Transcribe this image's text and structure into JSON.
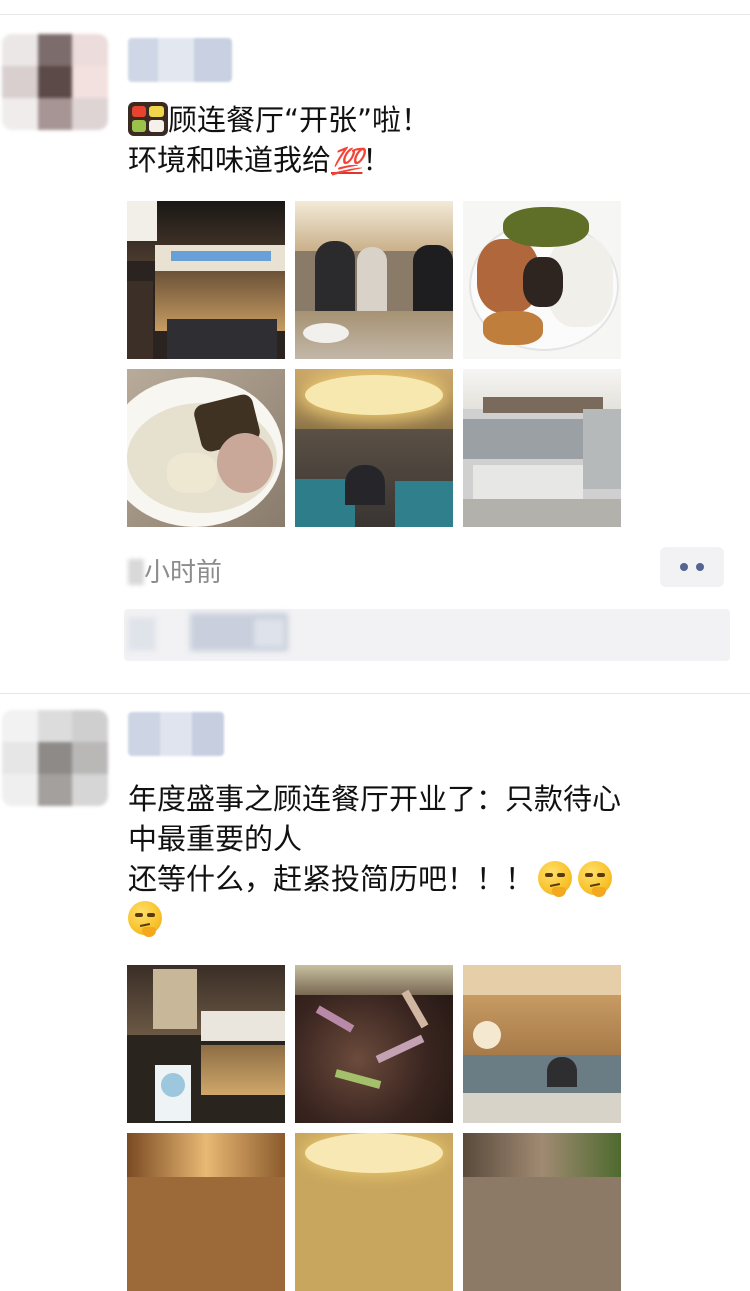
{
  "posts": [
    {
      "text_line1": "顾连餐厅“开张”啦！",
      "text_line2_prefix": "环境和味道我给",
      "text_line2_suffix": "！",
      "emoji_100": "💯",
      "time_visible": "小时前",
      "icons": [
        "bento-box-icon",
        "hundred-points-icon"
      ]
    },
    {
      "text_line1": "年度盛事之顾连餐厅开业了：只款待心",
      "text_line2": "中最重要的人",
      "text_line3_prefix": "还等什么，赶紧投简历吧！！！",
      "icons": [
        "thinking-face-icon",
        "thinking-face-icon",
        "thinking-face-icon"
      ]
    }
  ],
  "colors": {
    "text_primary": "#111111",
    "time_gray": "#8c8c8c",
    "more_dots": "#52648f",
    "bar_bg": "#f2f2f4"
  }
}
